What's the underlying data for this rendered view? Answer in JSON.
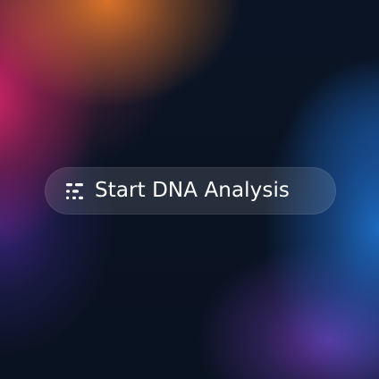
{
  "button": {
    "label": "Start DNA Analysis",
    "icon": "dna-icon"
  }
}
